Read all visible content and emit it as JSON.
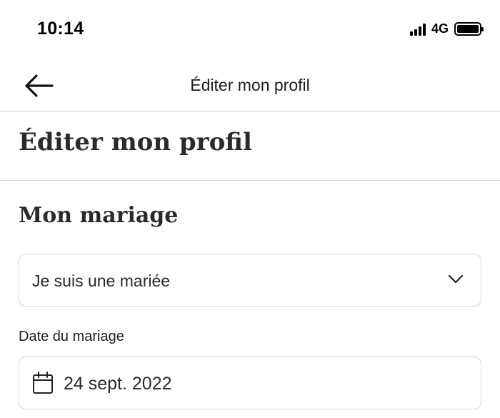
{
  "status_bar": {
    "time": "10:14",
    "network": "4G",
    "battery_level": 1.0,
    "signal_bars": 4
  },
  "nav": {
    "title": "Éditer mon profil",
    "back_icon": "arrow-left-icon"
  },
  "page": {
    "title": "Éditer mon profil"
  },
  "wedding_section": {
    "title": "Mon mariage",
    "role_select": {
      "value": "Je suis une mariée",
      "icon": "chevron-down-icon"
    },
    "date_field": {
      "label": "Date du mariage",
      "value": "24 sept. 2022",
      "icon": "calendar-icon"
    }
  },
  "colors": {
    "text": "#1d1d1d",
    "divider": "#cfcfcf",
    "field_border": "#d6d6d6",
    "background": "#ffffff"
  }
}
